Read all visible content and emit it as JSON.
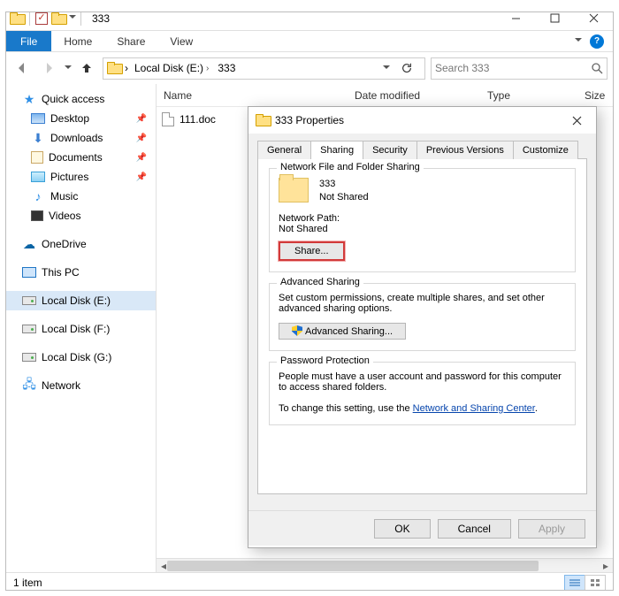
{
  "window": {
    "title": "333"
  },
  "ribbon": {
    "file": "File",
    "home": "Home",
    "share": "Share",
    "view": "View"
  },
  "addr": {
    "seg1": "Local Disk (E:)",
    "seg2": "333"
  },
  "search": {
    "placeholder": "Search 333"
  },
  "columns": {
    "name": "Name",
    "date": "Date modified",
    "type": "Type",
    "size": "Size"
  },
  "nav": {
    "quick": "Quick access",
    "desktop": "Desktop",
    "downloads": "Downloads",
    "documents": "Documents",
    "pictures": "Pictures",
    "music": "Music",
    "videos": "Videos",
    "onedrive": "OneDrive",
    "thispc": "This PC",
    "driveE": "Local Disk (E:)",
    "driveF": "Local Disk (F:)",
    "driveG": "Local Disk (G:)",
    "network": "Network"
  },
  "files": {
    "f1": "111.doc"
  },
  "status": {
    "count": "1 item"
  },
  "dlg": {
    "title": "333 Properties",
    "tabs": {
      "general": "General",
      "sharing": "Sharing",
      "security": "Security",
      "previous": "Previous Versions",
      "customize": "Customize"
    },
    "nfs": {
      "legend": "Network File and Folder Sharing",
      "name": "333",
      "state": "Not Shared",
      "pathlabel": "Network Path:",
      "pathval": "Not Shared",
      "share": "Share..."
    },
    "adv": {
      "legend": "Advanced Sharing",
      "desc": "Set custom permissions, create multiple shares, and set other advanced sharing options.",
      "btn": "Advanced Sharing..."
    },
    "pwd": {
      "legend": "Password Protection",
      "desc": "People must have a user account and password for this computer to access shared folders.",
      "pre": "To change this setting, use the ",
      "link": "Network and Sharing Center",
      "post": "."
    },
    "buttons": {
      "ok": "OK",
      "cancel": "Cancel",
      "apply": "Apply"
    }
  }
}
